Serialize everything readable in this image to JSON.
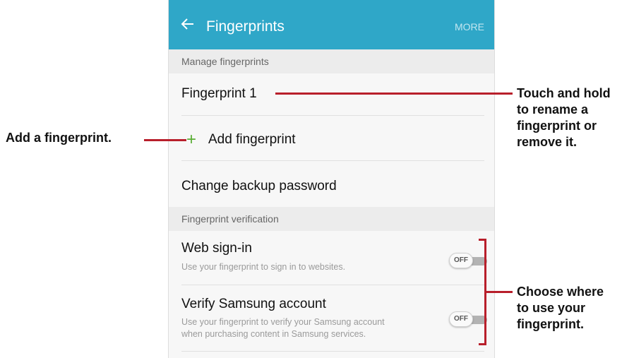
{
  "app_bar": {
    "back_icon": "arrow-left-icon",
    "title": "Fingerprints",
    "more_label": "MORE",
    "color": "#2fa7c8"
  },
  "manage_section": {
    "header": "Manage fingerprints",
    "fingerprint_1": "Fingerprint 1",
    "add_icon": "plus-icon",
    "add_fingerprint": "Add fingerprint",
    "change_backup_password": "Change backup password"
  },
  "verification_section": {
    "header": "Fingerprint verification",
    "web_signin": {
      "title": "Web sign-in",
      "subtitle": "Use your fingerprint to sign in to websites.",
      "toggle": "OFF"
    },
    "verify_samsung": {
      "title": "Verify Samsung account",
      "subtitle_line1": "Use your fingerprint to verify your Samsung account",
      "subtitle_line2": "when purchasing content in Samsung services.",
      "toggle": "OFF"
    }
  },
  "callouts": {
    "add": "Add a fingerprint.",
    "touch_hold": [
      "Touch and hold",
      "to rename a",
      "fingerprint or",
      "remove it."
    ],
    "choose": [
      "Choose where",
      "to use your",
      "fingerprint."
    ],
    "line_color": "#b81f2b"
  }
}
